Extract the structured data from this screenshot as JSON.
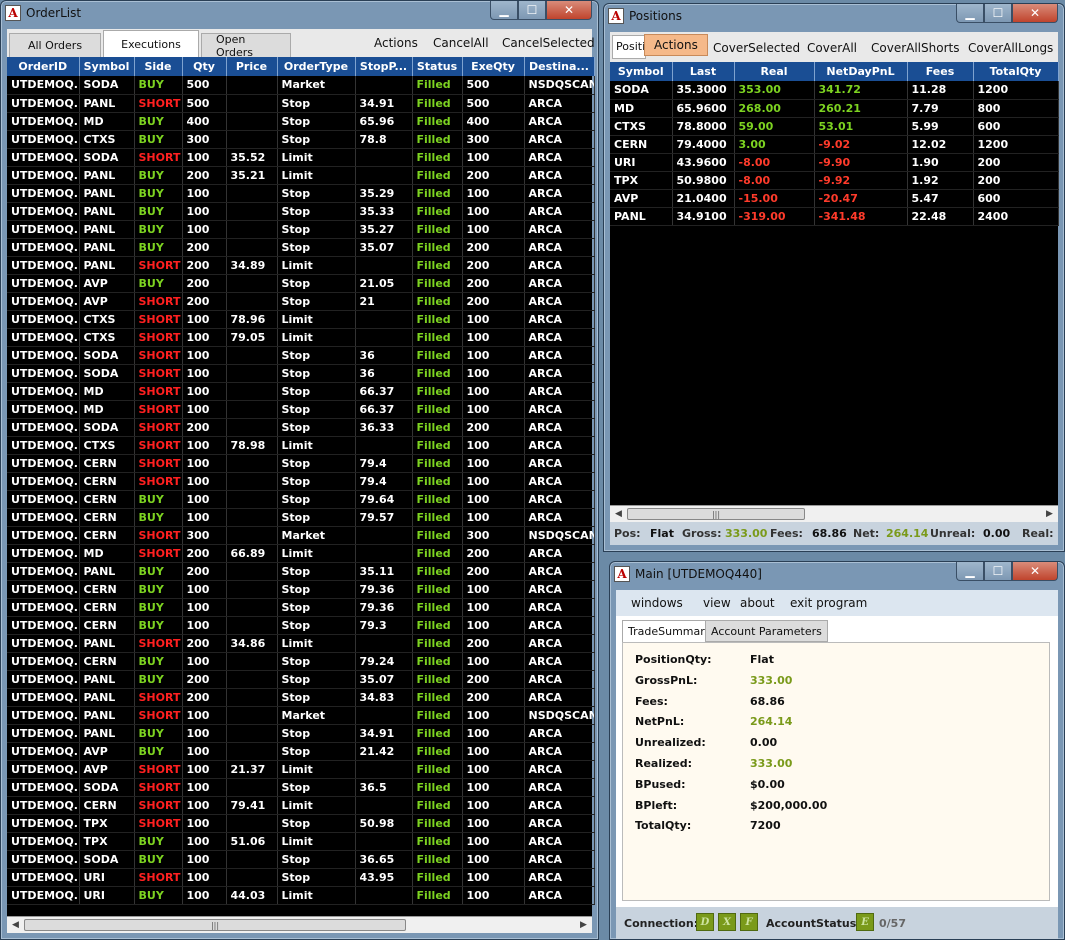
{
  "orderlist": {
    "title": "OrderList",
    "tabs": [
      "All Orders",
      "Executions",
      "Open Orders"
    ],
    "actions": [
      "Actions",
      "CancelAll",
      "CancelSelected"
    ],
    "columns": [
      "OrderID",
      "Symbol",
      "Side",
      "Qty",
      "Price",
      "OrderType",
      "StopP...",
      "Status",
      "ExeQty",
      "Destina..."
    ],
    "rows": [
      [
        "UTDEMOQ...",
        "SODA",
        "BUY",
        "500",
        "",
        "Market",
        "",
        "Filled",
        "500",
        "NSDQSCAN"
      ],
      [
        "UTDEMOQ...",
        "PANL",
        "SHORT",
        "500",
        "",
        "Stop",
        "34.91",
        "Filled",
        "500",
        "ARCA"
      ],
      [
        "UTDEMOQ...",
        "MD",
        "BUY",
        "400",
        "",
        "Stop",
        "65.96",
        "Filled",
        "400",
        "ARCA"
      ],
      [
        "UTDEMOQ...",
        "CTXS",
        "BUY",
        "300",
        "",
        "Stop",
        "78.8",
        "Filled",
        "300",
        "ARCA"
      ],
      [
        "UTDEMOQ...",
        "SODA",
        "SHORT",
        "100",
        "35.52",
        "Limit",
        "",
        "Filled",
        "100",
        "ARCA"
      ],
      [
        "UTDEMOQ...",
        "PANL",
        "BUY",
        "200",
        "35.21",
        "Limit",
        "",
        "Filled",
        "200",
        "ARCA"
      ],
      [
        "UTDEMOQ...",
        "PANL",
        "BUY",
        "100",
        "",
        "Stop",
        "35.29",
        "Filled",
        "100",
        "ARCA"
      ],
      [
        "UTDEMOQ...",
        "PANL",
        "BUY",
        "100",
        "",
        "Stop",
        "35.33",
        "Filled",
        "100",
        "ARCA"
      ],
      [
        "UTDEMOQ...",
        "PANL",
        "BUY",
        "100",
        "",
        "Stop",
        "35.27",
        "Filled",
        "100",
        "ARCA"
      ],
      [
        "UTDEMOQ...",
        "PANL",
        "BUY",
        "200",
        "",
        "Stop",
        "35.07",
        "Filled",
        "200",
        "ARCA"
      ],
      [
        "UTDEMOQ...",
        "PANL",
        "SHORT",
        "200",
        "34.89",
        "Limit",
        "",
        "Filled",
        "200",
        "ARCA"
      ],
      [
        "UTDEMOQ...",
        "AVP",
        "BUY",
        "200",
        "",
        "Stop",
        "21.05",
        "Filled",
        "200",
        "ARCA"
      ],
      [
        "UTDEMOQ...",
        "AVP",
        "SHORT",
        "200",
        "",
        "Stop",
        "21",
        "Filled",
        "200",
        "ARCA"
      ],
      [
        "UTDEMOQ...",
        "CTXS",
        "SHORT",
        "100",
        "78.96",
        "Limit",
        "",
        "Filled",
        "100",
        "ARCA"
      ],
      [
        "UTDEMOQ...",
        "CTXS",
        "SHORT",
        "100",
        "79.05",
        "Limit",
        "",
        "Filled",
        "100",
        "ARCA"
      ],
      [
        "UTDEMOQ...",
        "SODA",
        "SHORT",
        "100",
        "",
        "Stop",
        "36",
        "Filled",
        "100",
        "ARCA"
      ],
      [
        "UTDEMOQ...",
        "SODA",
        "SHORT",
        "100",
        "",
        "Stop",
        "36",
        "Filled",
        "100",
        "ARCA"
      ],
      [
        "UTDEMOQ...",
        "MD",
        "SHORT",
        "100",
        "",
        "Stop",
        "66.37",
        "Filled",
        "100",
        "ARCA"
      ],
      [
        "UTDEMOQ...",
        "MD",
        "SHORT",
        "100",
        "",
        "Stop",
        "66.37",
        "Filled",
        "100",
        "ARCA"
      ],
      [
        "UTDEMOQ...",
        "SODA",
        "SHORT",
        "200",
        "",
        "Stop",
        "36.33",
        "Filled",
        "200",
        "ARCA"
      ],
      [
        "UTDEMOQ...",
        "CTXS",
        "SHORT",
        "100",
        "78.98",
        "Limit",
        "",
        "Filled",
        "100",
        "ARCA"
      ],
      [
        "UTDEMOQ...",
        "CERN",
        "SHORT",
        "100",
        "",
        "Stop",
        "79.4",
        "Filled",
        "100",
        "ARCA"
      ],
      [
        "UTDEMOQ...",
        "CERN",
        "SHORT",
        "100",
        "",
        "Stop",
        "79.4",
        "Filled",
        "100",
        "ARCA"
      ],
      [
        "UTDEMOQ...",
        "CERN",
        "BUY",
        "100",
        "",
        "Stop",
        "79.64",
        "Filled",
        "100",
        "ARCA"
      ],
      [
        "UTDEMOQ...",
        "CERN",
        "BUY",
        "100",
        "",
        "Stop",
        "79.57",
        "Filled",
        "100",
        "ARCA"
      ],
      [
        "UTDEMOQ...",
        "CERN",
        "SHORT",
        "300",
        "",
        "Market",
        "",
        "Filled",
        "300",
        "NSDQSCAN"
      ],
      [
        "UTDEMOQ...",
        "MD",
        "SHORT",
        "200",
        "66.89",
        "Limit",
        "",
        "Filled",
        "200",
        "ARCA"
      ],
      [
        "UTDEMOQ...",
        "PANL",
        "BUY",
        "200",
        "",
        "Stop",
        "35.11",
        "Filled",
        "200",
        "ARCA"
      ],
      [
        "UTDEMOQ...",
        "CERN",
        "BUY",
        "100",
        "",
        "Stop",
        "79.36",
        "Filled",
        "100",
        "ARCA"
      ],
      [
        "UTDEMOQ...",
        "CERN",
        "BUY",
        "100",
        "",
        "Stop",
        "79.36",
        "Filled",
        "100",
        "ARCA"
      ],
      [
        "UTDEMOQ...",
        "CERN",
        "BUY",
        "100",
        "",
        "Stop",
        "79.3",
        "Filled",
        "100",
        "ARCA"
      ],
      [
        "UTDEMOQ...",
        "PANL",
        "SHORT",
        "200",
        "34.86",
        "Limit",
        "",
        "Filled",
        "200",
        "ARCA"
      ],
      [
        "UTDEMOQ...",
        "CERN",
        "BUY",
        "100",
        "",
        "Stop",
        "79.24",
        "Filled",
        "100",
        "ARCA"
      ],
      [
        "UTDEMOQ...",
        "PANL",
        "BUY",
        "200",
        "",
        "Stop",
        "35.07",
        "Filled",
        "200",
        "ARCA"
      ],
      [
        "UTDEMOQ...",
        "PANL",
        "SHORT",
        "200",
        "",
        "Stop",
        "34.83",
        "Filled",
        "200",
        "ARCA"
      ],
      [
        "UTDEMOQ...",
        "PANL",
        "SHORT",
        "100",
        "",
        "Market",
        "",
        "Filled",
        "100",
        "NSDQSCAN"
      ],
      [
        "UTDEMOQ...",
        "PANL",
        "BUY",
        "100",
        "",
        "Stop",
        "34.91",
        "Filled",
        "100",
        "ARCA"
      ],
      [
        "UTDEMOQ...",
        "AVP",
        "BUY",
        "100",
        "",
        "Stop",
        "21.42",
        "Filled",
        "100",
        "ARCA"
      ],
      [
        "UTDEMOQ...",
        "AVP",
        "SHORT",
        "100",
        "21.37",
        "Limit",
        "",
        "Filled",
        "100",
        "ARCA"
      ],
      [
        "UTDEMOQ...",
        "SODA",
        "SHORT",
        "100",
        "",
        "Stop",
        "36.5",
        "Filled",
        "100",
        "ARCA"
      ],
      [
        "UTDEMOQ...",
        "CERN",
        "SHORT",
        "100",
        "79.41",
        "Limit",
        "",
        "Filled",
        "100",
        "ARCA"
      ],
      [
        "UTDEMOQ...",
        "TPX",
        "SHORT",
        "100",
        "",
        "Stop",
        "50.98",
        "Filled",
        "100",
        "ARCA"
      ],
      [
        "UTDEMOQ...",
        "TPX",
        "BUY",
        "100",
        "51.06",
        "Limit",
        "",
        "Filled",
        "100",
        "ARCA"
      ],
      [
        "UTDEMOQ...",
        "SODA",
        "BUY",
        "100",
        "",
        "Stop",
        "36.65",
        "Filled",
        "100",
        "ARCA"
      ],
      [
        "UTDEMOQ...",
        "URI",
        "SHORT",
        "100",
        "",
        "Stop",
        "43.95",
        "Filled",
        "100",
        "ARCA"
      ],
      [
        "UTDEMOQ...",
        "URI",
        "BUY",
        "100",
        "44.03",
        "Limit",
        "",
        "Filled",
        "100",
        "ARCA"
      ]
    ]
  },
  "positions": {
    "title": "Positions",
    "tab": "Positi",
    "actions": [
      "Actions",
      "CoverSelected",
      "CoverAll",
      "CoverAllShorts",
      "CoverAllLongs"
    ],
    "columns": [
      "Symbol",
      "Last",
      "Real",
      "NetDayPnL",
      "Fees",
      "TotalQty"
    ],
    "rows": [
      [
        "SODA",
        "35.3000",
        "353.00",
        "341.72",
        "11.28",
        "1200"
      ],
      [
        "MD",
        "65.9600",
        "268.00",
        "260.21",
        "7.79",
        "800"
      ],
      [
        "CTXS",
        "78.8000",
        "59.00",
        "53.01",
        "5.99",
        "600"
      ],
      [
        "CERN",
        "79.4000",
        "3.00",
        "-9.02",
        "12.02",
        "1200"
      ],
      [
        "URI",
        "43.9600",
        "-8.00",
        "-9.90",
        "1.90",
        "200"
      ],
      [
        "TPX",
        "50.9800",
        "-8.00",
        "-9.92",
        "1.92",
        "200"
      ],
      [
        "AVP",
        "21.0400",
        "-15.00",
        "-20.47",
        "5.47",
        "600"
      ],
      [
        "PANL",
        "34.9100",
        "-319.00",
        "-341.48",
        "22.48",
        "2400"
      ]
    ],
    "status": {
      "pos_label": "Pos:",
      "pos": "Flat",
      "gross_label": "Gross:",
      "gross": "333.00",
      "fees_label": "Fees:",
      "fees": "68.86",
      "net_label": "Net:",
      "net": "264.14",
      "unreal_label": "Unreal:",
      "unreal": "0.00",
      "real_label": "Real:"
    }
  },
  "main": {
    "title": "Main [UTDEMOQ440]",
    "menu": [
      "windows",
      "view",
      "about",
      "exit program"
    ],
    "tabs": [
      "TradeSummary",
      "Account Parameters"
    ],
    "summary": [
      {
        "label": "PositionQty:",
        "value": "Flat"
      },
      {
        "label": "GrossPnL:",
        "value": "333.00"
      },
      {
        "label": "Fees:",
        "value": "68.86"
      },
      {
        "label": "NetPnL:",
        "value": "264.14"
      },
      {
        "label": "Unrealized:",
        "value": "0.00"
      },
      {
        "label": "Realized:",
        "value": "333.00"
      },
      {
        "label": "BPused:",
        "value": "$0.00"
      },
      {
        "label": "BPleft:",
        "value": "$200,000.00"
      },
      {
        "label": "TotalQty:",
        "value": "7200"
      }
    ],
    "connection_label": "Connection:",
    "leds": [
      "D",
      "X",
      "F"
    ],
    "account_status_label": "AccountStatus:",
    "account_led": "E",
    "account_count": "0/57"
  },
  "colors": {
    "header_blue": "#1a4e94",
    "buy_green": "#7dd321",
    "short_red": "#ff2020",
    "actions_orange": "#f5b98a"
  }
}
